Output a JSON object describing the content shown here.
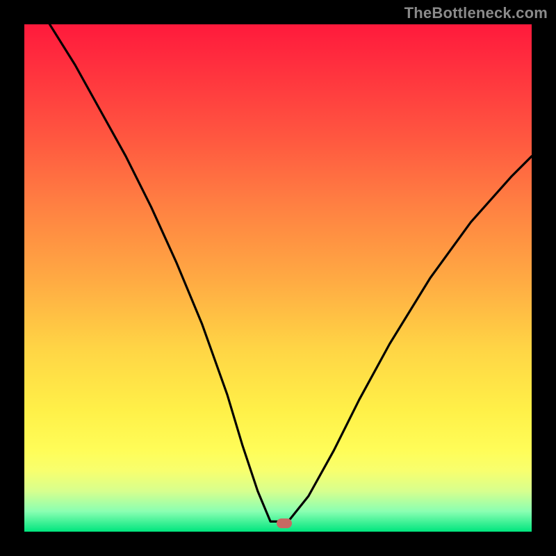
{
  "watermark": {
    "text": "TheBottleneck.com"
  },
  "plot": {
    "gradient_css": "linear-gradient(to bottom, #ff1a3c 0%, #ff2f3e 8%, #ff5640 22%, #ff8142 36%, #ffa943 50%, #ffd545 64%, #fff048 76%, #fffd58 84%, #f8ff6e 88%, #d7ff8e 92%, #8affb2 96%, #00e57e 100%)",
    "marker": {
      "x_frac": 0.512,
      "y_frac": 0.984,
      "color": "#c76a63"
    }
  },
  "chart_data": {
    "type": "line",
    "title": "",
    "xlabel": "",
    "ylabel": "",
    "xlim": [
      0,
      1
    ],
    "ylim": [
      0,
      1
    ],
    "series": [
      {
        "name": "bottleneck-curve",
        "x": [
          0.05,
          0.1,
          0.15,
          0.2,
          0.25,
          0.3,
          0.35,
          0.4,
          0.43,
          0.46,
          0.485,
          0.52,
          0.56,
          0.61,
          0.66,
          0.72,
          0.8,
          0.88,
          0.96,
          1.0
        ],
        "values": [
          1.0,
          0.92,
          0.83,
          0.74,
          0.64,
          0.53,
          0.41,
          0.27,
          0.17,
          0.08,
          0.02,
          0.02,
          0.07,
          0.16,
          0.26,
          0.37,
          0.5,
          0.61,
          0.7,
          0.74
        ]
      }
    ],
    "flat_segment": {
      "x_start": 0.485,
      "x_end": 0.52,
      "y": 0.02
    },
    "marker_point": {
      "x": 0.512,
      "y": 0.016
    },
    "background_gradient_stops": [
      {
        "pos": 0.0,
        "color": "#ff1a3c"
      },
      {
        "pos": 0.5,
        "color": "#ffa943"
      },
      {
        "pos": 0.84,
        "color": "#fffd58"
      },
      {
        "pos": 1.0,
        "color": "#00e57e"
      }
    ]
  }
}
